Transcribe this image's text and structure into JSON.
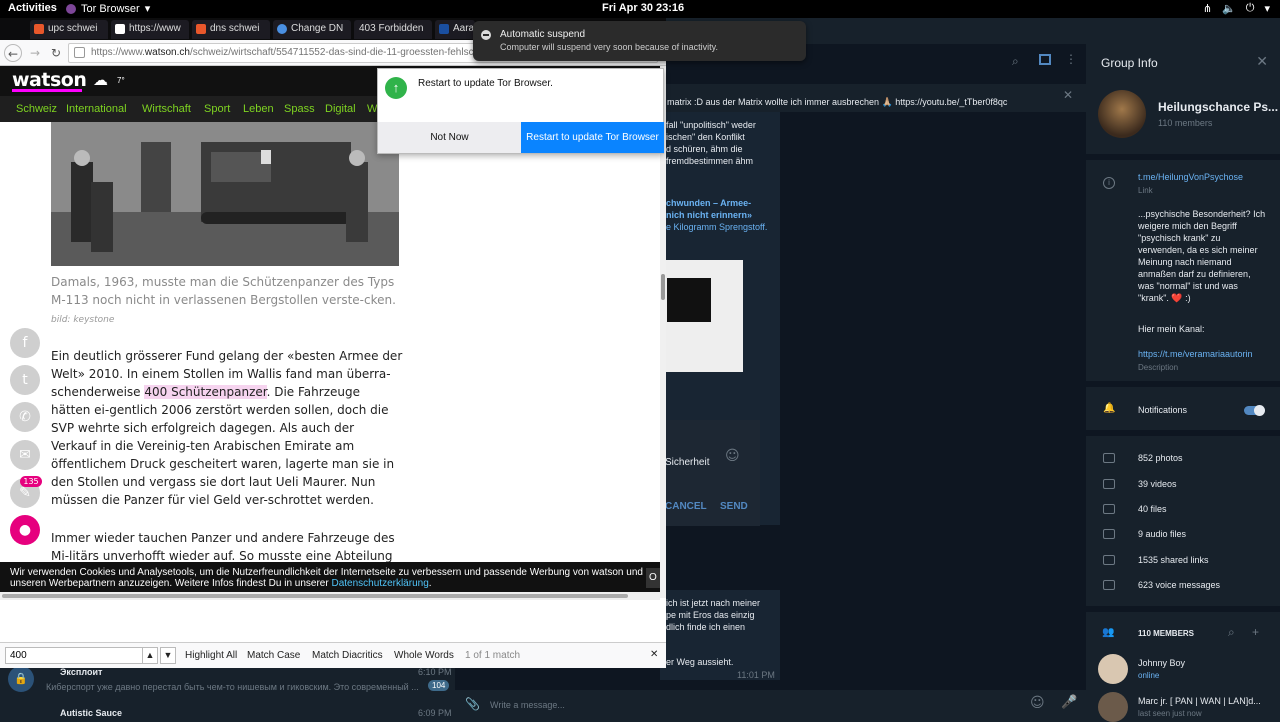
{
  "topbar": {
    "activities": "Activities",
    "app_name": "Tor Browser",
    "clock": "Fri Apr 30  23:16"
  },
  "notification": {
    "title": "Automatic suspend",
    "body": "Computer will suspend very soon because of inactivity."
  },
  "browser": {
    "tabs": [
      {
        "label": "upc schwei"
      },
      {
        "label": "https://www"
      },
      {
        "label": "dns schwei"
      },
      {
        "label": "Change DN"
      },
      {
        "label": "403 Forbidden"
      },
      {
        "label": "Aara"
      }
    ],
    "url_prefix": "https://www.",
    "url_domain": "watson.ch",
    "url_path": "/schweiz/wirtschaft/554711552-das-sind-die-11-groessten-fehlsch"
  },
  "doorhanger": {
    "message": "Restart to update Tor Browser.",
    "not_now": "Not Now",
    "restart": "Restart to update Tor Browser"
  },
  "watson": {
    "logo": "watson",
    "nav": [
      "Schweiz",
      "International",
      "Wirtschaft",
      "Sport",
      "Leben",
      "Spass",
      "Digital",
      "W"
    ],
    "caption": "Damals, 1963, musste man die Schützenpanzer des Typs M-113 noch nicht in verlassenen Bergstollen verste-cken.",
    "caption_credit": "bild: keystone",
    "para1_before": "Ein deutlich grösserer Fund gelang der «besten Armee der Welt» 2010. In einem Stollen im Wallis fand man überra-schenderweise ",
    "para1_highlight": "400 Schützenpanzer",
    "para1_after": ". Die Fahrzeuge hätten ei-gentlich 2006 zerstört werden sollen, doch die SVP wehrte sich erfolgreich dagegen. Als auch der Verkauf in die Vereinig-ten Arabischen Emirate am öffentlichem Druck gescheitert waren, lagerte man sie in den Stollen und vergass sie dort laut Ueli Maurer. Nun müssen die Panzer für viel Geld ver-schrottet werden.",
    "para2": "Immer wieder tauchen Panzer und andere Fahrzeuge des Mi-litärs unverhofft wieder auf. So musste eine Abteilung der",
    "comment_count": "135",
    "cookie_text": "Wir verwenden Cookies und Analysetools, um die Nutzerfreundlichkeit der Internetseite zu verbessern und passende Werbung von watson und unseren Werbepartnern anzuzeigen. Weitere Infos findest Du in unserer ",
    "cookie_link": "Datenschutzerklärung",
    "cookie_ok": "O"
  },
  "findbar": {
    "query": "400",
    "highlight_all": "Highlight All",
    "match_case": "Match Case",
    "match_diacritics": "Match Diacritics",
    "whole_words": "Whole Words",
    "status": "1 of 1 match"
  },
  "telegram": {
    "group_info_title": "Group Info",
    "group_name": "Heilungschance Ps...",
    "members_count": "110 members",
    "link": "t.me/HeilungVonPsychose",
    "link_label": "Link",
    "description": "...psychische Besonderheit? Ich weigere mich den Begriff \"psychisch krank\" zu verwenden, da es sich meiner Meinung nach niemand anmaßen darf zu definieren, was \"normal\" ist und was \"krank\". ❤️ :)",
    "channel_label": "Hier mein Kanal:",
    "channel_link": "https://t.me/veramariaautorin",
    "description_label": "Description",
    "notifications": "Notifications",
    "stats": [
      "852 photos",
      "39 videos",
      "40 files",
      "9 audio files",
      "1535 shared links",
      "623 voice messages"
    ],
    "members_header": "110 MEMBERS",
    "members": [
      {
        "name": "Johnny Boy",
        "status": "online"
      },
      {
        "name": "Marc jr. [ PAN | WAN | LAN]d...",
        "status": "last seen just now"
      }
    ],
    "pinned": "matrix :D aus der Matrix wollte ich immer ausbrechen 🙏🏼 https://youtu.be/_tTber0f8qc",
    "chat_snippet1": "fall \"unpolitisch\" weder",
    "chat_snippet2": "ischen\" den Konflikt",
    "chat_snippet3": "d schüren, ähm die",
    "chat_snippet4": "fremdbestimmen ähm",
    "chat_snippet5": "chwunden – Armee-",
    "chat_snippet6": "nich nicht erinnern»",
    "chat_snippet7": "e Kilogramm Sprengstoff.",
    "cancel": "CANCEL",
    "send": "SEND",
    "snippet_sicherheit": "Sicherheit",
    "snippet_b1": "ich ist jetzt nach meiner",
    "snippet_b2": "pe mit Eros das einzig",
    "snippet_b3": "dlich finde ich einen",
    "snippet_b4": "er Weg aussieht.",
    "time1": "11:01 PM",
    "chat1_name": "Экcплоит",
    "chat1_msg": "Киберспорт уже давно перестал быть чем-то нишевым и гиковским. Это современный ...",
    "chat1_time": "6:10 PM",
    "chat1_badge": "104",
    "chat2_name": "Autistic Sauce",
    "chat2_time": "6:09 PM",
    "compose_placeholder": "Write a message..."
  }
}
